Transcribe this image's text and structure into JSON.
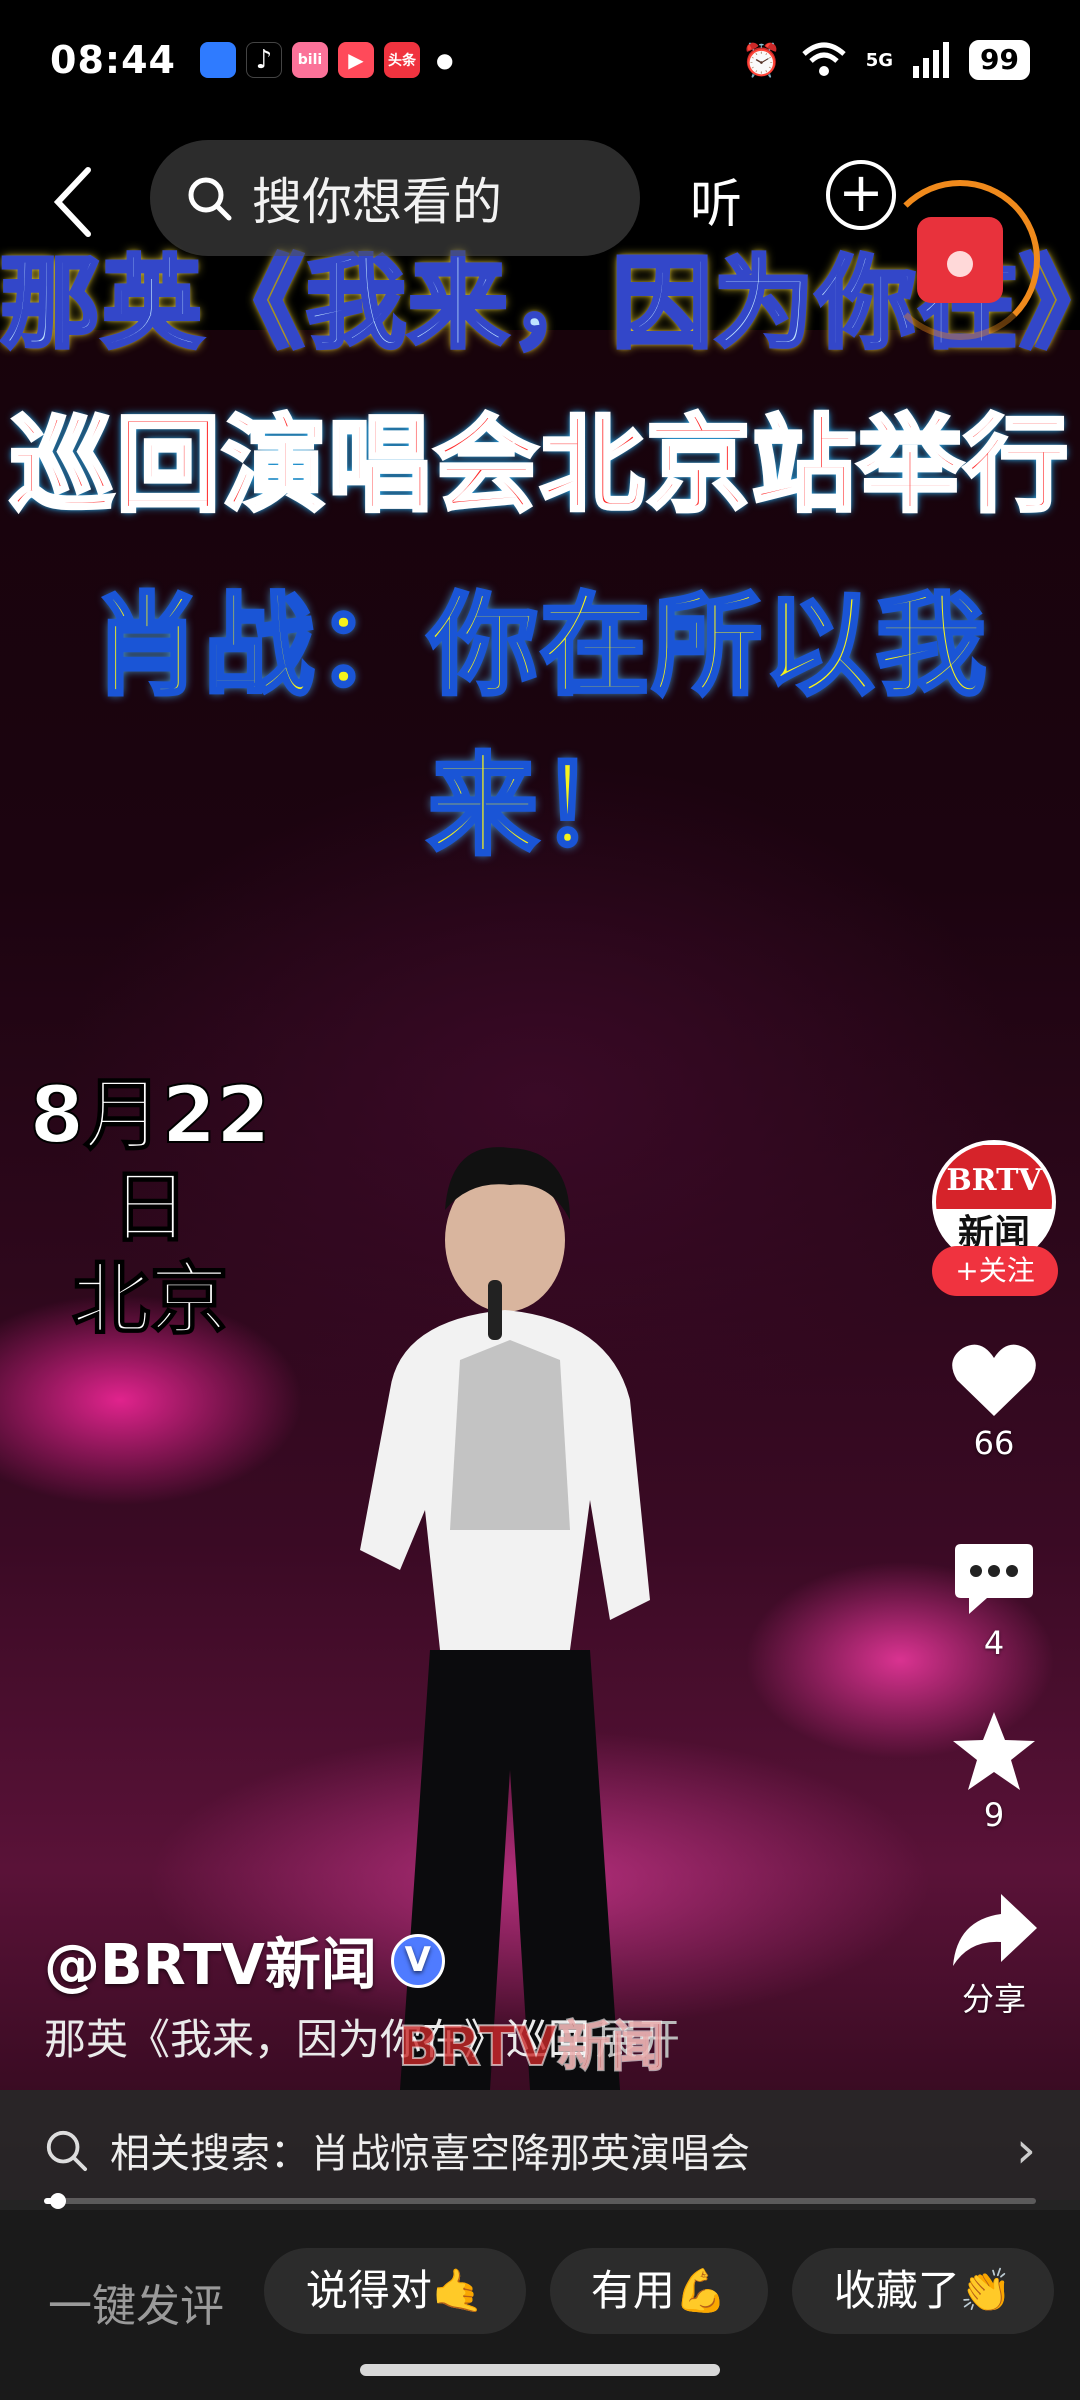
{
  "status_bar": {
    "time": "08:44",
    "signal": "5G",
    "battery": "99",
    "apps": [
      {
        "name": "browser-app-icon",
        "color": "#2f7bff",
        "label": ""
      },
      {
        "name": "tiktok-app-icon",
        "color": "#000000",
        "label": ""
      },
      {
        "name": "bilibili-app-icon",
        "color": "#fb7299",
        "label": "bili"
      },
      {
        "name": "video-app-icon",
        "color": "#ff4a5a",
        "label": ""
      },
      {
        "name": "toutiao-app-icon",
        "color": "#f0333f",
        "label": "头条"
      }
    ]
  },
  "topbar": {
    "search_placeholder": "搜你想看的",
    "listen_label": "听"
  },
  "captions": {
    "line1": "那英《我来，因为你在》",
    "line2": "巡回演唱会北京站举行",
    "line3": "肖战：你在所以我来！"
  },
  "overlay": {
    "date": "8月22日",
    "city": "北京"
  },
  "rail": {
    "avatar_top": "BRTV",
    "avatar_bottom": "新闻",
    "follow_label": "+关注",
    "likes": "66",
    "comments": "4",
    "favorites": "9",
    "share_label": "分享"
  },
  "info": {
    "account": "@BRTV新闻",
    "verified": "V",
    "description": "那英《我来，因为你在》巡回",
    "expand": "展开",
    "watermark": "BRTV新闻"
  },
  "related": {
    "text": "相关搜索：肖战惊喜空降那英演唱会"
  },
  "progress": 0.01,
  "bottom_bar": {
    "quick_label": "一键发评",
    "chips": [
      "说得对🤙",
      "有用💪",
      "收藏了👏"
    ]
  }
}
